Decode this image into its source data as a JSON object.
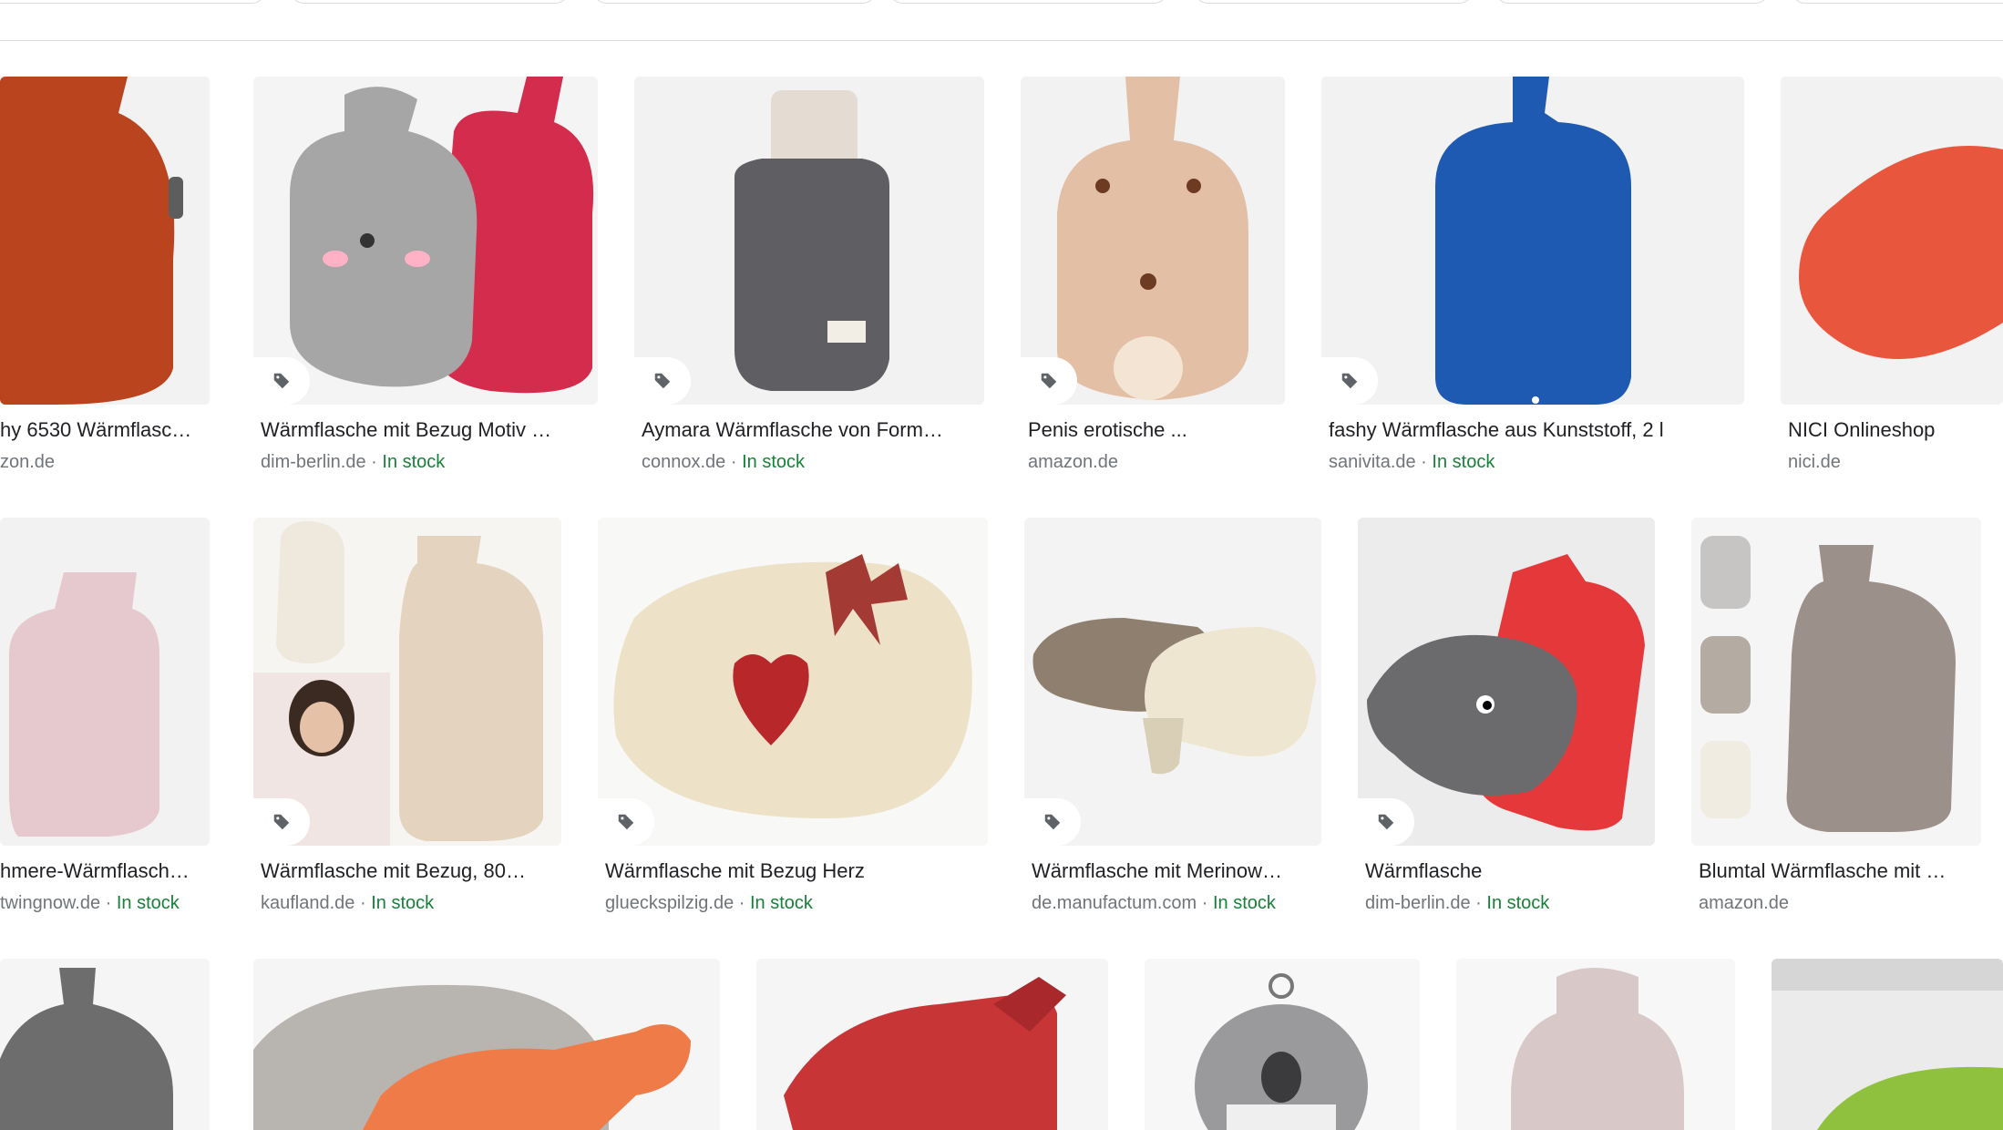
{
  "colors": {
    "stock": "#188038",
    "source": "#70757a",
    "title": "#202124",
    "border": "#dadce0"
  },
  "results": [
    {
      "title": "hy 6530 Wärmflasc…",
      "source": "zon.de",
      "stock": "",
      "dot": ""
    },
    {
      "title": "Wärmflasche mit Bezug Motiv …",
      "source": "dim-berlin.de",
      "dot": " · ",
      "stock": "In stock"
    },
    {
      "title": "Aymara Wärmflasche von Form…",
      "source": "connox.de",
      "dot": " · ",
      "stock": "In stock"
    },
    {
      "title": "Penis erotische ...",
      "source": "amazon.de",
      "stock": "",
      "dot": ""
    },
    {
      "title": "fashy Wärmflasche aus Kunststoff, 2 l",
      "source": "sanivita.de",
      "dot": " · ",
      "stock": "In stock"
    },
    {
      "title": "NICI Onlineshop",
      "source": "nici.de",
      "stock": "",
      "dot": ""
    },
    {
      "title": "hmere-Wärmflasch…",
      "source": "twingnow.de",
      "dot": " · ",
      "stock": "In stock"
    },
    {
      "title": "Wärmflasche mit Bezug, 80…",
      "source": "kaufland.de",
      "dot": " · ",
      "stock": "In stock"
    },
    {
      "title": "Wärmflasche mit Bezug Herz",
      "source": "glueckspilzig.de",
      "dot": " · ",
      "stock": "In stock"
    },
    {
      "title": "Wärmflasche mit Merinow…",
      "source": "de.manufactum.com",
      "dot": " · ",
      "stock": "In stock"
    },
    {
      "title": "Wärmflasche",
      "source": "dim-berlin.de",
      "dot": " · ",
      "stock": "In stock"
    },
    {
      "title": "Blumtal Wärmflasche mit …",
      "source": "amazon.de",
      "stock": "",
      "dot": ""
    }
  ],
  "icons": {
    "price_tag": "price-tag-icon"
  }
}
